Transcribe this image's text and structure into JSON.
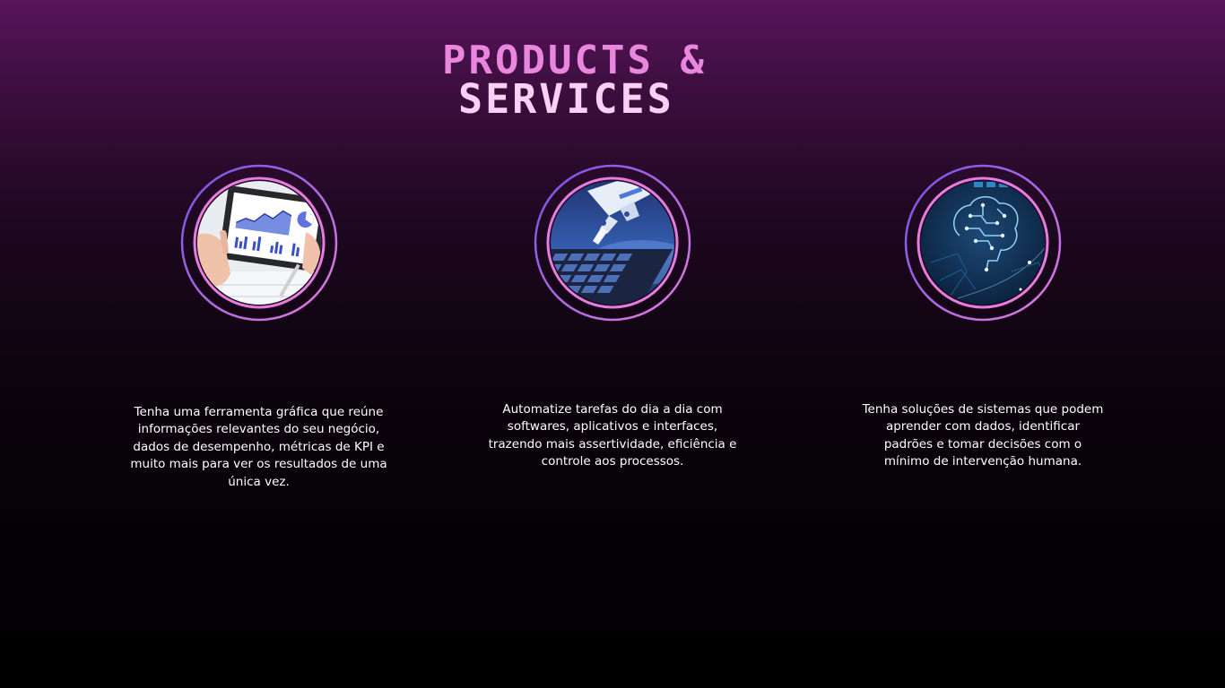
{
  "title": {
    "line1": "PRODUCTS &",
    "line2": "SERVICES"
  },
  "colors": {
    "title_line1": "#e986de",
    "title_line2": "#fbd0f6",
    "ring_gradient_start": "#7052e8",
    "ring_gradient_end": "#e77ce0",
    "background_top": "#58145a",
    "background_bottom": "#000000"
  },
  "services": [
    {
      "image": "analytics-tablet-photo",
      "description": "Tenha uma ferramenta gráfica que reúne informações relevantes do seu negócio, dados de desempenho, métricas de KPI e muito mais para ver os resultados de uma única vez."
    },
    {
      "image": "robot-hand-keyboard-photo",
      "description": "Automatize tarefas do dia a dia com softwares, aplicativos e interfaces, trazendo mais assertividade, eficiência e controle aos processos."
    },
    {
      "image": "circuit-brain-photo",
      "description": "Tenha soluções de sistemas que podem aprender com dados, identificar padrões e tomar decisões com o mínimo de intervenção humana."
    }
  ]
}
